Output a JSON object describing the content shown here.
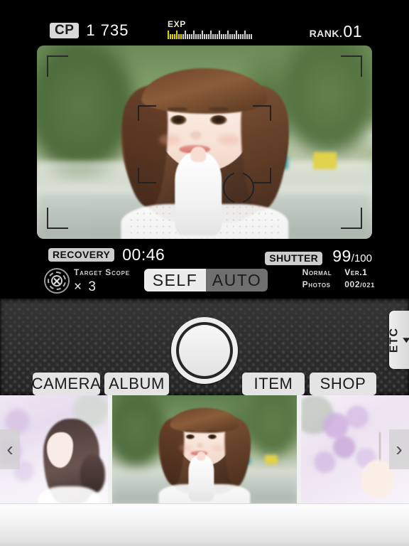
{
  "hud": {
    "cp_label": "CP",
    "cp_value": "1 735",
    "exp_label": "EXP",
    "exp_filled_ticks": 7,
    "exp_total_ticks": 40,
    "rank_label": "RANK.",
    "rank_value": "01"
  },
  "viewfinder": {
    "corner_bracket_icon": "corner-bracket-icon",
    "focus_frame_icon": "focus-frame-icon",
    "metering_ring_icon": "metering-ring-icon"
  },
  "info": {
    "recovery_label": "RECOVERY",
    "recovery_time": "00:46",
    "shutter_label": "SHUTTER",
    "shutter_count": "99",
    "shutter_max": "/100",
    "target_scope_icon": "target-scope-icon",
    "target_scope_label": "Target Scope",
    "target_scope_multiplier": "×",
    "target_scope_count": "3",
    "mode_self": "SELF",
    "mode_auto": "AUTO",
    "mode_selected": "SELF",
    "meta_normal_label": "Normal",
    "meta_ver_value": "Ver.1",
    "meta_photos_label": "Photos",
    "meta_photos_value": "002",
    "meta_photos_max": "/021"
  },
  "camera_body": {
    "shutter_button_label": "shutter-button",
    "etc_label": "ETC",
    "etc_arrow_icon": "triangle-left-icon"
  },
  "nav": {
    "buttons": [
      {
        "label": "CAMERA"
      },
      {
        "label": "ALBUM"
      },
      {
        "label": "ITEM"
      },
      {
        "label": "SHOP"
      }
    ]
  },
  "strip": {
    "prev_arrow": "‹",
    "next_arrow": "›",
    "thumbnails": [
      {
        "name": "thumbnail-left"
      },
      {
        "name": "thumbnail-center"
      },
      {
        "name": "thumbnail-right"
      }
    ]
  },
  "colors": {
    "background": "#000000",
    "badge_bg": "#cccccc",
    "exp_fill": "#e0d400",
    "toggle_active_bg": "#ececec",
    "toggle_inactive_bg": "#6f6f6f",
    "leather": "#2e2e2e",
    "bottom_panel": "#f4f4f4"
  }
}
